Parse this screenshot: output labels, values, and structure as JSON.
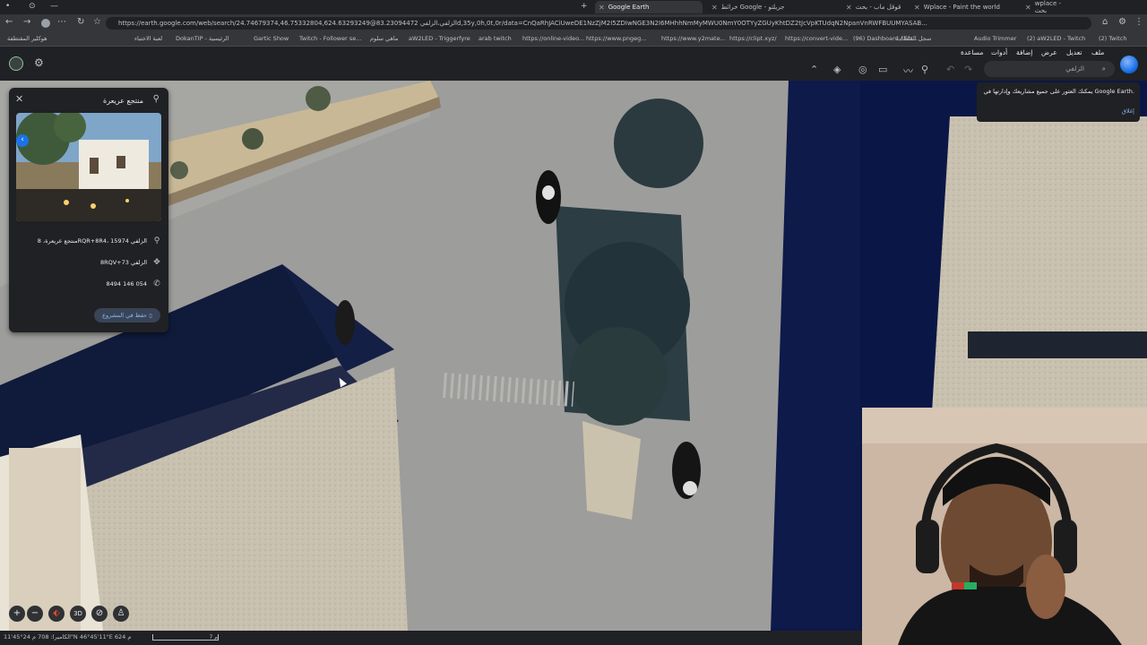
{
  "browser": {
    "tabs": [
      {
        "title": "wplace - بحث"
      },
      {
        "title": "Wplace - Paint the world"
      },
      {
        "title": "قوقل ماب - بحث"
      },
      {
        "title": "خرائط Google - جريلتو"
      },
      {
        "title": "Google Earth",
        "active": true
      }
    ],
    "url": "https://earth.google.com/web/search/24.74679374,46.75332804,624.63293249@الزلفي،الزلفي 83.23094472d,35y,0h,0t,0r/data=CnQaRhJACiUweDE1NzZjM2I5ZDIwNGE3N2I6MHhhNmMyMWU0NmY0OTYyZGUyKhtDZ2tJcVpKTUdqN2NpanVnRWFBUUMYASAB...",
    "bookmarks": [
      "جميع الإشارات المرجعية",
      "DokanTIP - الرئيسية",
      "لعبة الاختباء",
      "Gartic Show",
      "Twitch - Follower se...",
      "ماهي سلوم",
      "aW2LED - Triggerfyre",
      "arab twitch",
      "https://online-video...",
      "https://www.pngeg...",
      "https://www.y2mate...",
      "https://clipt.xyz/",
      "https://convert-vide...",
      "(96) Dashboard / Str...",
      "سجل الفلطات",
      "Audio Trimmer",
      "(2) aW2LED - Twitch",
      "(2) Twitch",
      "هوكلير المقتطفة"
    ]
  },
  "earth": {
    "menu": [
      "ملف",
      "تعديل",
      "عرض",
      "إضافة",
      "أدوات",
      "مساعدة"
    ],
    "search_placeholder": "الزلفي",
    "toast_text": "يمكنك العثور على جميع مشاريعك وإدارتها في Google Earth.",
    "toast_button": "إغلاق",
    "place": {
      "title": "منتجع عريعرة",
      "address": "منتجع عريعرة، 8RQR+8R4، الزلفي 15974",
      "plus_code": "8RQV+73 الزلفي",
      "phone": "8494 146 054",
      "save_button": "حفظ في المشروع"
    },
    "map_controls": [
      "+",
      "−",
      "3D"
    ],
    "status_text": "الكاميرا: 708 م   24°45'11\"N 46°45'11\"E   624 م",
    "scale_label": "7 م"
  },
  "colors": {
    "accent": "#1a73e8",
    "link": "#8ab4f8"
  }
}
